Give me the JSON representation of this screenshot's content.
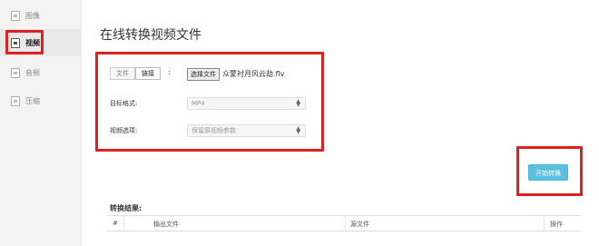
{
  "sidebar": {
    "items": [
      {
        "label": "图像"
      },
      {
        "label": "视频"
      },
      {
        "label": "音频"
      },
      {
        "label": "压缩"
      }
    ]
  },
  "main": {
    "title": "在线转换视频文件",
    "source_tabs": [
      "文件",
      "链接"
    ],
    "colon": ":",
    "choose_file_label": "选择文件",
    "file_name": "众蒙衬月风云劫.flv",
    "target_format_label": "目标格式:",
    "target_format_value": "MP4",
    "video_options_label": "视频选项:",
    "video_options_value": "保留原视频参数",
    "start_button_label": "开始转换",
    "result_label": "转换结果:",
    "table_headers": [
      "#",
      "输出文件",
      "源文件",
      "操作"
    ]
  },
  "colors": {
    "highlight_border": "#e02020",
    "start_button": "#5bc0de"
  }
}
